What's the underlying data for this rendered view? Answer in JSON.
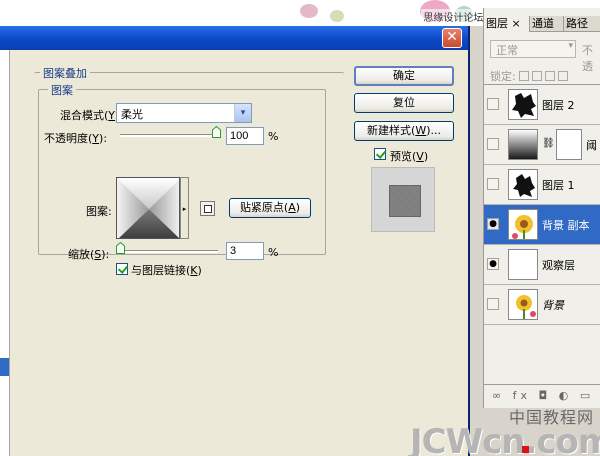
{
  "watermark_top": "思缘设计论坛 www.MISSYUAN.COM",
  "dialog": {
    "close_glyph": "✕",
    "section_title": "图案叠加",
    "group_title": "图案",
    "blend_mode": {
      "label_pre": "混合模式(",
      "label_key": "Y",
      "label_post": "):",
      "value": "柔光",
      "arrow": "▾"
    },
    "opacity": {
      "label_pre": "不透明度(",
      "label_key": "Y",
      "label_post": "):",
      "value": "100",
      "unit": "%",
      "level_percent": 100
    },
    "pattern": {
      "label": "图案:",
      "menu_arrow": "▸",
      "snap_pre": "贴紧原点(",
      "snap_key": "A",
      "snap_post": ")"
    },
    "scale": {
      "label_pre": "缩放(",
      "label_key": "S",
      "label_post": "):",
      "value": "3",
      "unit": "%",
      "level_percent": 3
    },
    "link": {
      "label_pre": "与图层链接(",
      "label_key": "K",
      "label_post": ")",
      "checked": true
    },
    "buttons": {
      "ok": "确定",
      "reset": "复位",
      "new_style_pre": "新建样式(",
      "new_style_key": "W",
      "new_style_post": ")..."
    },
    "preview": {
      "label_pre": "预览(",
      "label_key": "V",
      "label_post": ")",
      "checked": true
    }
  },
  "layers_panel": {
    "tabs": [
      {
        "label": "图层 ×",
        "active": true
      },
      {
        "label": "通道",
        "active": false
      },
      {
        "label": "路径",
        "active": false
      }
    ],
    "blend_mode": "正常",
    "opacity_label": "不透",
    "lock_label": "锁定:",
    "layers": [
      {
        "name": "图层 2",
        "visible": false,
        "selected": false
      },
      {
        "name": "阈",
        "visible": false,
        "selected": false
      },
      {
        "name": "图层 1",
        "visible": false,
        "selected": false
      },
      {
        "name": "背景 副本",
        "visible": true,
        "selected": true
      },
      {
        "name": "观察层",
        "visible": true,
        "selected": false
      },
      {
        "name": "背景",
        "visible": false,
        "selected": false
      }
    ],
    "bottom_icons": "∞ fx ◘ ◐ ▭"
  },
  "watermark": {
    "cn": "中国教程网",
    "en": "JCWcn.com"
  }
}
